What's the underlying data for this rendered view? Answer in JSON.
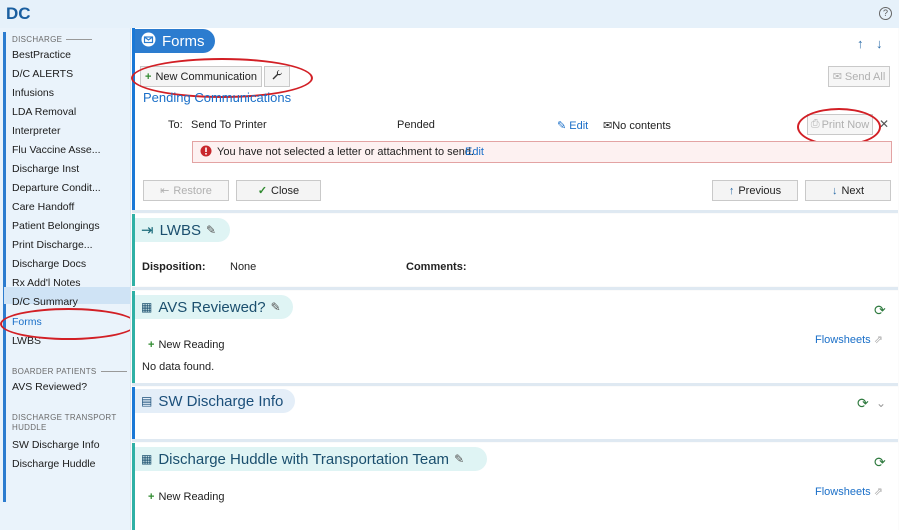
{
  "app": {
    "title": "DC",
    "help_glyph": "?"
  },
  "sidebar": {
    "groups": {
      "discharge": "Discharge",
      "boarder": "Boarder Patients",
      "transport": "Discharge Transport Huddle"
    },
    "items": [
      "BestPractice",
      "D/C ALERTS",
      "Infusions",
      "LDA Removal",
      "Interpreter",
      "Flu Vaccine Asse...",
      "Discharge Inst",
      "Departure Condit...",
      "Care Handoff",
      "Patient Belongings",
      "Print Discharge...",
      "Discharge Docs",
      "Rx Add'l Notes",
      "D/C Summary",
      "Forms",
      "LWBS"
    ],
    "boarder_items": [
      "AVS Reviewed?"
    ],
    "transport_items": [
      "SW Discharge Info",
      "Discharge Huddle"
    ]
  },
  "forms": {
    "title": "Forms",
    "new_communication": "New Communication",
    "send_all": "Send All",
    "pending_header": "Pending Communications",
    "to_label": "To:",
    "to_value": "Send To Printer",
    "status": "Pended",
    "edit": "Edit",
    "no_contents": "No contents",
    "print_now": "Print Now",
    "error_msg": "You have not selected a letter or attachment to send.",
    "error_edit": "Edit",
    "restore": "Restore",
    "close": "Close",
    "previous": "Previous",
    "next": "Next"
  },
  "lwbs": {
    "title": "LWBS",
    "disposition_label": "Disposition:",
    "disposition_value": "None",
    "comments_label": "Comments:"
  },
  "avs": {
    "title": "AVS Reviewed?",
    "new_reading": "New Reading",
    "flowsheets": "Flowsheets",
    "no_data": "No data found."
  },
  "sw": {
    "title": "SW Discharge Info"
  },
  "huddle": {
    "title": "Discharge Huddle with Transportation Team",
    "new_reading": "New Reading",
    "flowsheets": "Flowsheets"
  }
}
